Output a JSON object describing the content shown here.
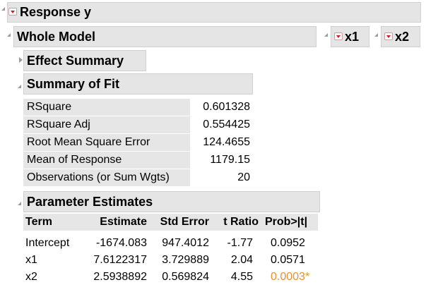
{
  "response": {
    "title": "Response y"
  },
  "whole_model": {
    "title": "Whole Model",
    "leverage_tabs": [
      "x1",
      "x2"
    ]
  },
  "effect_summary": {
    "title": "Effect Summary"
  },
  "summary_of_fit": {
    "title": "Summary of Fit",
    "rows": [
      {
        "label": "RSquare",
        "value": "0.601328"
      },
      {
        "label": "RSquare Adj",
        "value": "0.554425"
      },
      {
        "label": "Root Mean Square Error",
        "value": "124.4655"
      },
      {
        "label": "Mean of Response",
        "value": "1179.15"
      },
      {
        "label": "Observations (or Sum Wgts)",
        "value": "20"
      }
    ]
  },
  "parameter_estimates": {
    "title": "Parameter Estimates",
    "columns": [
      "Term",
      "Estimate",
      "Std Error",
      "t Ratio",
      "Prob>|t|"
    ],
    "rows": [
      {
        "term": "Intercept",
        "estimate": "-1674.083",
        "std_error": "947.4012",
        "t_ratio": "-1.77",
        "prob": "0.0952"
      },
      {
        "term": "x1",
        "estimate": "7.6122317",
        "std_error": "3.729889",
        "t_ratio": "2.04",
        "prob": "0.0571"
      },
      {
        "term": "x2",
        "estimate": "2.5938892",
        "std_error": "0.569824",
        "t_ratio": "4.55",
        "prob": "0.0003*"
      }
    ],
    "significant_color": "#e8922a"
  }
}
